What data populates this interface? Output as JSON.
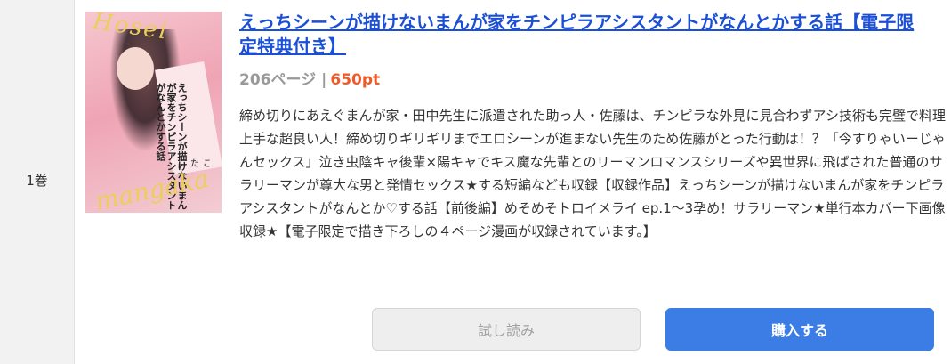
{
  "volume": {
    "label": "1巻"
  },
  "book": {
    "cover_alt": "表紙",
    "cover_script_top": "Hosei",
    "cover_script_bottom": "mangaka",
    "cover_title_vertical": "えっちシーンが描けないまんが家をチンピラアシスタントがなんとかする話",
    "cover_author": "にたこ",
    "title": "えっちシーンが描けないまんが家をチンピラアシスタントがなんとかする話【電子限定特典付き】",
    "pages": "206ページ",
    "separator": "|",
    "price": "650pt",
    "description": "締め切りにあえぐまんが家・田中先生に派遣された助っ人・佐藤は、チンピラな外見に見合わずアシ技術も完璧で料理上手な超良い人！締め切りギリギリまでエロシーンが進まない先生のため佐藤がとった行動は！？「今すりゃいーじゃんセックス」泣き虫陰キャ後輩×陽キャでキス魔な先輩とのリーマンロマンスシリーズや異世界に飛ばされた普通のサラリーマンが尊大な男と発情セックス★する短編なども収録【収録作品】えっちシーンが描けないまんが家をチンピラアシスタントがなんとか♡する話【前後編】めそめそトロイメライ ep.1〜3孕め！サラリーマン★単行本カバー下画像収録★【電子限定で描き下ろしの４ページ漫画が収録されています。】"
  },
  "actions": {
    "trial_label": "試し読み",
    "buy_label": "購入する"
  },
  "colors": {
    "link": "#1a4fd6",
    "price": "#f05a28",
    "buy_button": "#3b7de4",
    "trial_button": "#eeeeee"
  }
}
